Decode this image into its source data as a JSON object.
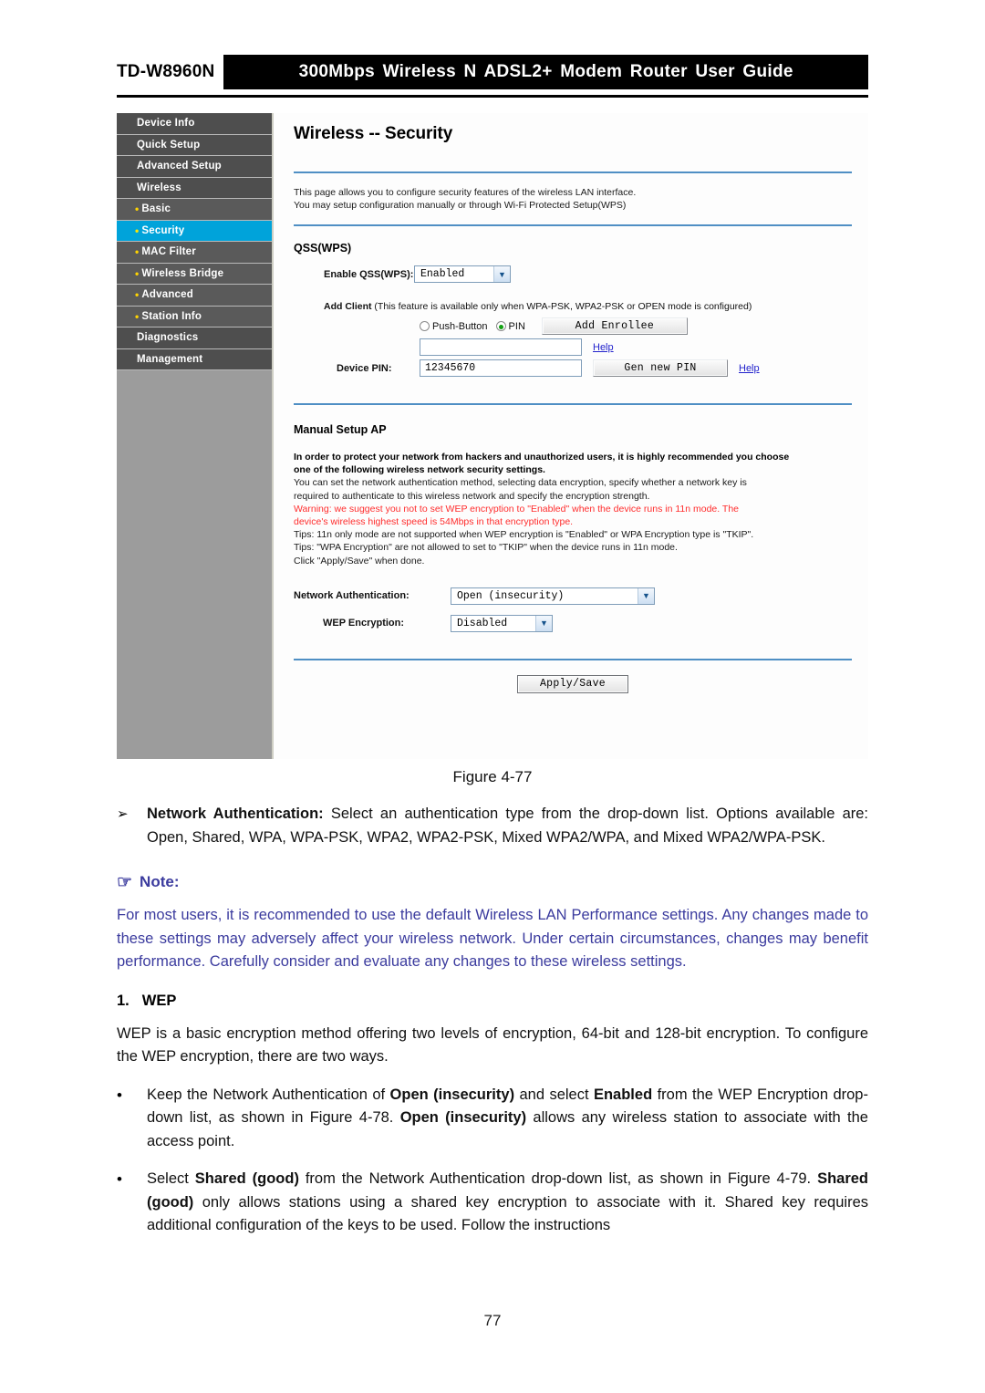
{
  "header": {
    "model": "TD-W8960N",
    "title": "300Mbps Wireless N ADSL2+ Modem Router User Guide"
  },
  "figure": {
    "sidebar": {
      "items": [
        {
          "label": "Device Info",
          "sub": false,
          "active": false
        },
        {
          "label": "Quick Setup",
          "sub": false,
          "active": false
        },
        {
          "label": "Advanced Setup",
          "sub": false,
          "active": false
        },
        {
          "label": "Wireless",
          "sub": false,
          "active": false
        },
        {
          "label": "Basic",
          "sub": true,
          "active": false
        },
        {
          "label": "Security",
          "sub": true,
          "active": true
        },
        {
          "label": "MAC Filter",
          "sub": true,
          "active": false
        },
        {
          "label": "Wireless Bridge",
          "sub": true,
          "active": false
        },
        {
          "label": "Advanced",
          "sub": true,
          "active": false
        },
        {
          "label": "Station Info",
          "sub": true,
          "active": false
        },
        {
          "label": "Diagnostics",
          "sub": false,
          "active": false
        },
        {
          "label": "Management",
          "sub": false,
          "active": false
        }
      ]
    },
    "panel": {
      "title": "Wireless -- Security",
      "description_line1": "This page allows you to configure security features of the wireless LAN interface.",
      "description_line2": "You may setup configuration manually or through Wi-Fi Protected Setup(WPS)",
      "qss": {
        "heading": "QSS(WPS)",
        "enable_label": "Enable QSS(WPS):",
        "enable_value": "Enabled",
        "add_client_bold": "Add Client",
        "add_client_rest": " (This feature is available only when WPA-PSK, WPA2-PSK or OPEN mode is configured)",
        "push_button_label": "Push-Button",
        "pin_label": "PIN",
        "add_enrollee_label": "Add Enrollee",
        "pin_input_value": "",
        "help_label_1": "Help",
        "device_pin_label": "Device PIN:",
        "device_pin_value": "12345670",
        "gen_new_pin_label": "Gen new PIN",
        "help_label_2": "Help"
      },
      "manual": {
        "heading": "Manual Setup AP",
        "bold_line1": "In order to protect your network from hackers and unauthorized users, it is highly recommended you choose",
        "bold_line2": "one of the following wireless network security settings.",
        "line3": "You can set the network authentication method, selecting data encryption, specify whether a network key is",
        "line4": "required to authenticate to this wireless network and specify the encryption strength.",
        "warn_line1": "Warning: we suggest you not to set WEP encryption to \"Enabled\" when the device runs in 11n mode. The",
        "warn_line2": "device's wireless highest speed is 54Mbps in that encryption type.",
        "tip_line1": "Tips: 11n only mode are not supported when WEP encryption is \"Enabled\" or WPA Encryption type is \"TKIP\".",
        "tip_line2": "Tips: \"WPA Encryption\" are not allowed to set to \"TKIP\" when the device runs in 11n mode.",
        "tip_line3": "Click \"Apply/Save\" when done.",
        "net_auth_label": "Network Authentication:",
        "net_auth_value": "Open (insecurity)",
        "wep_label": "WEP Encryption:",
        "wep_value": "Disabled",
        "apply_label": "Apply/Save"
      }
    }
  },
  "document": {
    "figure_caption": "Figure 4-77",
    "bullet_marker_arrow": "➢",
    "bullet_marker_dot": "●",
    "net_auth_item": {
      "bold": "Network Authentication:",
      "text": " Select an authentication type from the drop-down list. Options available are: Open, Shared, WPA, WPA-PSK, WPA2, WPA2-PSK, Mixed WPA2/WPA, and Mixed WPA2/WPA-PSK."
    },
    "note": {
      "icon": "hand-pointing-icon",
      "label": "Note:",
      "body": "For most users, it is recommended to use the default Wireless LAN Performance settings. Any changes made to these settings may adversely affect your wireless network. Under certain circumstances, changes may benefit performance. Carefully consider and evaluate any changes to these wireless settings."
    },
    "wep_section": {
      "number": "1.",
      "heading": "WEP",
      "paragraph": "WEP is a basic encryption method offering two levels of encryption, 64-bit and 128-bit encryption. To configure the WEP encryption, there are two ways."
    },
    "bullets": [
      {
        "p1": "Keep the Network Authentication of ",
        "b1": "Open (insecurity)",
        "p2": " and select ",
        "b2": "Enabled",
        "p3": " from the WEP Encryption drop-down list, as shown in Figure 4-78. ",
        "b3": "Open (insecurity)",
        "p4": " allows any wireless station to associate with the access point."
      },
      {
        "p1": "Select ",
        "b1": "Shared (good)",
        "p2": " from the Network Authentication drop-down list, as shown in Figure 4-79. ",
        "b2": "Shared (good)",
        "p3": " only allows stations using a shared key encryption to associate with it. Shared key requires additional configuration of the keys to be used. Follow the instructions",
        "b3": "",
        "p4": ""
      }
    ],
    "page_number": "77"
  }
}
